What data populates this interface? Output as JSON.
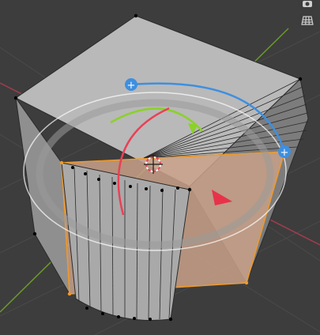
{
  "viewport": {
    "name": "3D Viewport",
    "colors": {
      "background": "#3d3d3d",
      "grid_line": "#4a4a4a",
      "x_axis": "#a23c4d",
      "y_axis": "#6b9a2a",
      "mesh_light": "#b9b9b9",
      "mesh_mid": "#9a9a9a",
      "mesh_dark": "#6e6e6e",
      "selected_face": "#c9a188",
      "selected_edge": "#f09a2a",
      "gizmo_x": "#e94156",
      "gizmo_y": "#8bd12a",
      "gizmo_z": "#3e8fe0",
      "gizmo_view": "#ffffff",
      "gizmo_trackball": "#9a9a9a",
      "arrow_normal": "#e8324a"
    }
  },
  "overlay_buttons": [
    {
      "id": "camera",
      "icon": "camera-icon",
      "interactable": true
    },
    {
      "id": "grid",
      "icon": "grid-view-icon",
      "interactable": true
    }
  ],
  "gizmo": {
    "mode": "rotate"
  }
}
